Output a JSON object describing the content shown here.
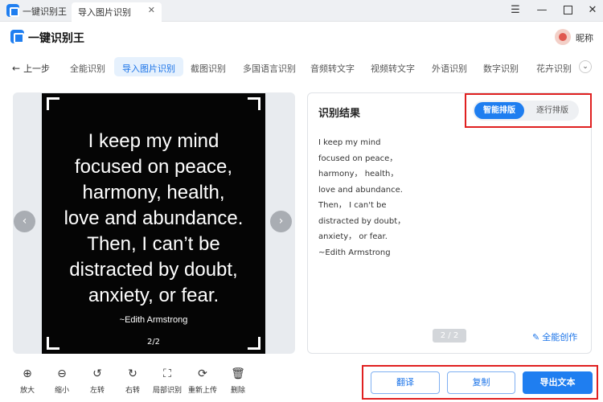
{
  "titlebar": {
    "app_name": "一键识别王",
    "tab_label": "导入图片识别",
    "tab_close": "✕"
  },
  "header": {
    "logo_text": "一键识别王",
    "nickname": "昵称"
  },
  "nav": {
    "back_label": "上一步",
    "tabs": [
      {
        "label": "全能识别"
      },
      {
        "label": "导入图片识别"
      },
      {
        "label": "截图识别"
      },
      {
        "label": "多国语言识别"
      },
      {
        "label": "音频转文字"
      },
      {
        "label": "视频转文字"
      },
      {
        "label": "外语识别"
      },
      {
        "label": "数字识别"
      },
      {
        "label": "花卉识别"
      }
    ],
    "active_tab": "导入图片识别"
  },
  "preview": {
    "quote_lines": [
      "I keep my mind",
      "focused on peace,",
      "harmony, health,",
      "love and abundance.",
      "Then, I can’t be",
      "distracted by doubt,",
      "anxiety, or fear."
    ],
    "author": "~Edith Armstrong",
    "page_indicator": "2/2"
  },
  "result": {
    "title": "识别结果",
    "mode_smart": "智能排版",
    "mode_line": "逐行排版",
    "lines": [
      "I keep my mind",
      "focused on peace，",
      "harmony， health，",
      "love and abundance.",
      "Then， I can't be",
      "distracted by doubt，",
      "anxiety， or fear.",
      "~Edith Armstrong"
    ],
    "page_indicator": "2 / 2",
    "create_label": "全能创作"
  },
  "toolbar": {
    "items": [
      {
        "label": "放大",
        "icon": "zoom-in-icon"
      },
      {
        "label": "缩小",
        "icon": "zoom-out-icon"
      },
      {
        "label": "左转",
        "icon": "rotate-left-icon"
      },
      {
        "label": "右转",
        "icon": "rotate-right-icon"
      },
      {
        "label": "局部识别",
        "icon": "partial-recognize-icon"
      },
      {
        "label": "重新上传",
        "icon": "reupload-icon"
      },
      {
        "label": "删除",
        "icon": "delete-icon"
      }
    ]
  },
  "actions": {
    "translate": "翻译",
    "copy": "复制",
    "export": "导出文本"
  },
  "colors": {
    "accent": "#1f7ef0",
    "highlight_box": "#e02020"
  }
}
